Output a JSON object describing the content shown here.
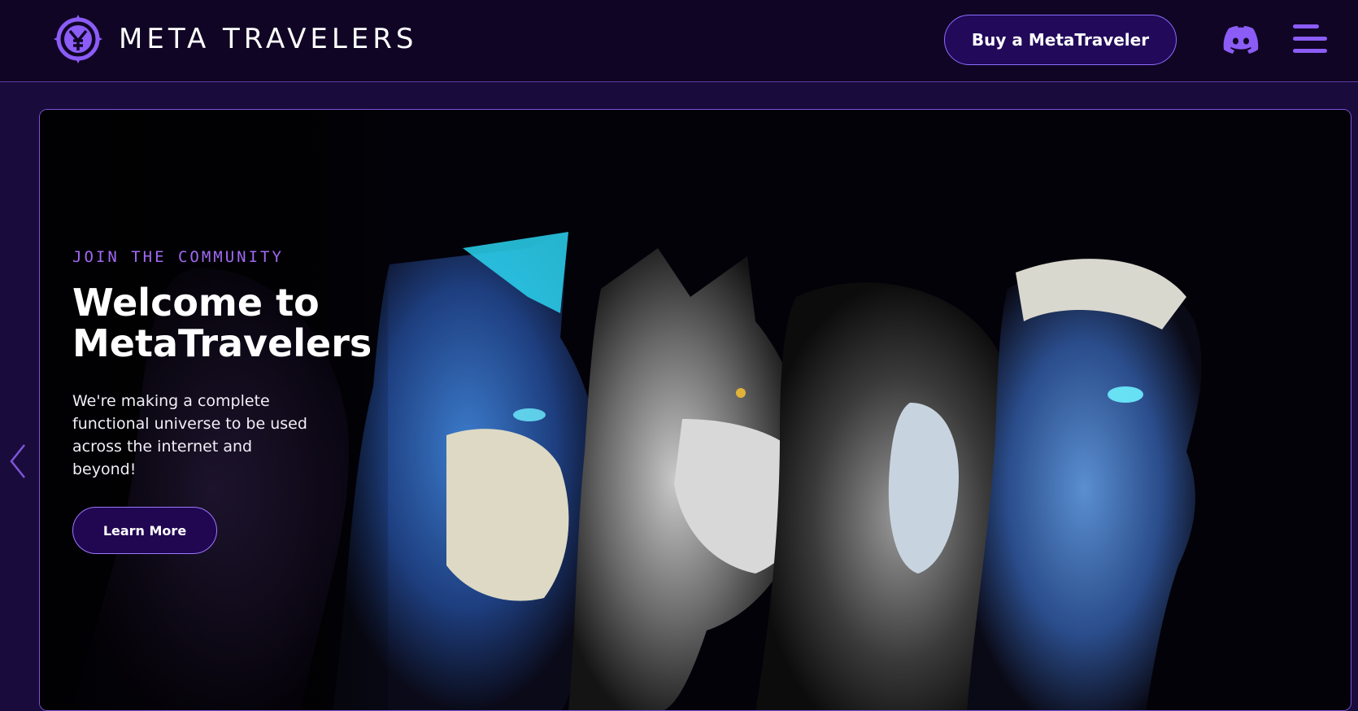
{
  "header": {
    "brand": "META TRAVELERS",
    "buy_label": "Buy a MetaTraveler"
  },
  "hero": {
    "eyebrow": "JOIN THE COMMUNITY",
    "title": "Welcome to MetaTravelers",
    "description": "We're making a complete functional universe to be used across the internet and beyond!",
    "cta_label": "Learn More"
  },
  "icons": {
    "logo": "metatravelers-logo-icon",
    "discord": "discord-icon",
    "menu": "hamburger-menu-icon",
    "prev": "chevron-left-icon"
  },
  "colors": {
    "header_bg": "#100524",
    "page_bg": "#1a0b3d",
    "accent": "#8b5cf6",
    "button_bg": "#22095a",
    "eyebrow": "#a169f3"
  }
}
